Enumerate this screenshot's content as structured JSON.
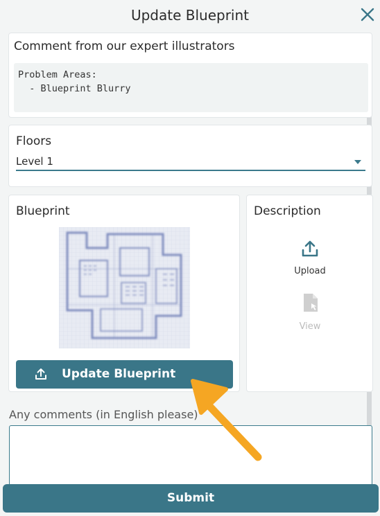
{
  "header": {
    "title": "Update Blueprint",
    "close_icon": "close-icon"
  },
  "comment_section": {
    "title": "Comment from our expert illustrators",
    "text": "Problem Areas:\n  - Blueprint Blurry"
  },
  "floors": {
    "label": "Floors",
    "selected": "Level 1"
  },
  "blueprint": {
    "label": "Blueprint",
    "image": "blurry-floor-plan-thumbnail",
    "update_button_label": "Update Blueprint",
    "update_button_icon": "upload-icon"
  },
  "description": {
    "label": "Description",
    "upload_label": "Upload",
    "upload_icon": "upload-icon",
    "view_label": "View",
    "view_icon": "document-view-icon"
  },
  "comments": {
    "label": "Any comments (in English please)",
    "value": ""
  },
  "footer": {
    "submit_label": "Submit"
  },
  "colors": {
    "accent": "#3a7688",
    "annotation_arrow": "#f5a623"
  }
}
